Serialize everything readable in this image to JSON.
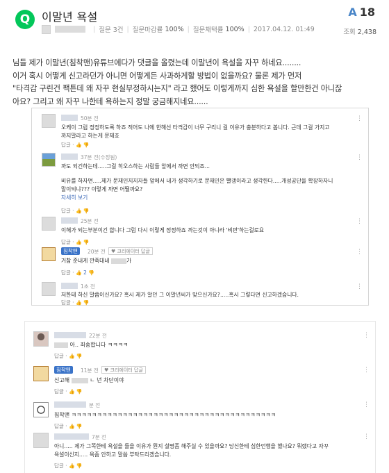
{
  "header": {
    "logo_letter": "Q",
    "title": "이말년 욕설",
    "question_count_label": "질문 3건",
    "deadline_rate_label": "질문마감률",
    "deadline_rate_value": "100%",
    "adopt_rate_label": "질문채택률",
    "adopt_rate_value": "100%",
    "datetime": "2017.04.12. 01:49",
    "answer_prefix": "A",
    "answer_count": "18",
    "views_label": "조회",
    "views_value": "2,438"
  },
  "question": {
    "lines": [
      "님들 제가 이말년(침착맨)유튜브에다가 댓글을 올렸는데 이말년이 욕설을 자꾸 하네요........",
      "이거 혹시 어떻게 신고라던가 아니면 어떻게든 사과하게할 방법이 없을까요? 물론 제가 먼저",
      " \"타격감 구린건 팩튼데 왜 자꾸 현실부정하시는지\" 라고 했어도 이렇게까지 심한 욕설을 할만한건 아니잖",
      "아요? 그리고 왜 자꾸 나한테 욕하는지 정말 궁금해지네요......"
    ]
  },
  "shot1": {
    "c1": {
      "time": "50분 전",
      "line1": "오케이 그럼 정정하도록 하죠 적어도 나에 한해선 타격감이 너무 구리니 걸 이유가 충분하다고 봅니다. 근데 그걸 가지고",
      "line2": "까지말라고 하는게 문제죠",
      "reply": "답글 ·",
      "thumbs": "👍 👎"
    },
    "c2": {
      "time": "37분 전(수정됨)",
      "line1": "까도 되긴하는데.....그걸 히오스하는 사람들 앞에서 까면 안되죠...",
      "line2": "비유를 하자면.....제가 문재인지지자들 앞에서 내가 생각하기로 문재인은 빨갱이라고 생각한다.....개성공단을 확장하자니",
      "line3": "말이되냐??? 이렇게 까면 어떨까요?",
      "more": "자세히 보기",
      "reply": "답글 ·",
      "thumbs": "👍 👎"
    },
    "c3": {
      "time": "25분 전",
      "line1": "이해가 되는부분이긴 합니다 그럼 다시 이렇게 정정하죠 까는것이 아니라 '비판'하는걸로요",
      "reply": "답글 ·",
      "thumbs": "👍 👎"
    },
    "c4": {
      "badge": "침착맨",
      "time": "20분 전",
      "creator_tag": "♥ 크리에이터 답글",
      "line1_a": "거참 준내게 깐죽대네",
      "line1_b": "가",
      "reply": "답글 ·",
      "like_count": "2",
      "thumbs_up": "👍",
      "thumbs_down": "👎"
    },
    "c5": {
      "time": "1초 전",
      "line1": "저한테 하신 말씀이신가요? 혹시 제가 알던 그 이말년씨가 맞으신가요?.....혹시 그렇다면 신고하겠습니다.",
      "reply": "답글 ·",
      "thumbs": "👍 👎"
    }
  },
  "shot2": {
    "d1": {
      "time": "22분 전",
      "line1": "아.. 죄송합니다 ㅋㅋㅋㅋ",
      "reply": "답글 ·",
      "thumbs": "👍 👎"
    },
    "d2": {
      "badge": "침착맨",
      "time": "11분 전",
      "creator_tag": "♥ 크리에이터 답글",
      "line1_a": "신고해",
      "line1_b": "ㄴ 년 차단이야",
      "reply": "답글 ·",
      "thumbs": "👍 👎"
    },
    "d3": {
      "time": "분 전",
      "line1": "침착맨 ㅋㅋㅋㅋㅋㅋㅋㅋㅋㅋㅋㅋㅋㅋㅋㅋㅋㅋㅋㅋㅋㅋㅋㅋㅋㅋㅋㅋㅋㅋㅋㅋㅋㅋㅋㅋㅋㅋㅋㅋ",
      "reply": "답글 ·",
      "thumbs": "👍 👎"
    },
    "d4": {
      "time": "7분 전",
      "line1": "아니..... 제가 그쪽한테 욕설을 들을 이유가 뭔지 설명좀 해주실 수 있을까요? 당신한테 심한언행을 했나요? 뭐랬다고 자꾸",
      "line2": "욕설이신지..... 욕좀 안하고 말씀 부탁드리겠습니다.",
      "reply": "답글 ·",
      "thumbs": "👍 👎"
    }
  },
  "icons": {
    "more_menu": "vertical-dots-icon"
  },
  "colors": {
    "logo_green": "#03c75a",
    "answer_blue": "#4a86c8",
    "badge_blue": "#3a73c8"
  }
}
